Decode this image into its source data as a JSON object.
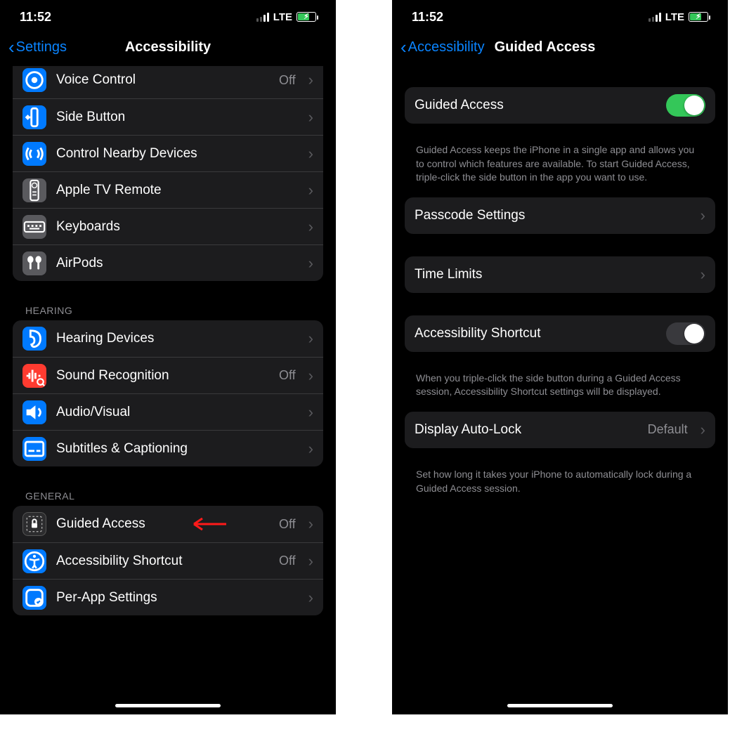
{
  "status": {
    "time": "11:52",
    "network": "LTE"
  },
  "left": {
    "back_label": "Settings",
    "title": "Accessibility",
    "group_physical": [
      {
        "label": "Voice Control",
        "value": "Off",
        "icon": "voice-control-icon",
        "color": "ic-blue"
      },
      {
        "label": "Side Button",
        "value": "",
        "icon": "side-button-icon",
        "color": "ic-blue"
      },
      {
        "label": "Control Nearby Devices",
        "value": "",
        "icon": "nearby-devices-icon",
        "color": "ic-blue"
      },
      {
        "label": "Apple TV Remote",
        "value": "",
        "icon": "appletv-remote-icon",
        "color": "ic-grey"
      },
      {
        "label": "Keyboards",
        "value": "",
        "icon": "keyboards-icon",
        "color": "ic-grey"
      },
      {
        "label": "AirPods",
        "value": "",
        "icon": "airpods-icon",
        "color": "ic-grey"
      }
    ],
    "section_hearing": "HEARING",
    "group_hearing": [
      {
        "label": "Hearing Devices",
        "value": "",
        "icon": "ear-icon",
        "color": "ic-blue"
      },
      {
        "label": "Sound Recognition",
        "value": "Off",
        "icon": "sound-recognition-icon",
        "color": "ic-red"
      },
      {
        "label": "Audio/Visual",
        "value": "",
        "icon": "audio-visual-icon",
        "color": "ic-blue"
      },
      {
        "label": "Subtitles & Captioning",
        "value": "",
        "icon": "subtitles-icon",
        "color": "ic-blue"
      }
    ],
    "section_general": "GENERAL",
    "group_general": [
      {
        "label": "Guided Access",
        "value": "Off",
        "icon": "guided-access-icon",
        "color": "ic-dark"
      },
      {
        "label": "Accessibility Shortcut",
        "value": "Off",
        "icon": "accessibility-icon",
        "color": "ic-blue"
      },
      {
        "label": "Per-App Settings",
        "value": "",
        "icon": "per-app-icon",
        "color": "ic-blue"
      }
    ]
  },
  "right": {
    "back_label": "Accessibility",
    "title": "Guided Access",
    "row_main": "Guided Access",
    "main_toggle_on": true,
    "main_footer": "Guided Access keeps the iPhone in a single app and allows you to control which features are available. To start Guided Access, triple-click the side button in the app you want to use.",
    "row_passcode": "Passcode Settings",
    "row_timelimits": "Time Limits",
    "row_shortcut": "Accessibility Shortcut",
    "shortcut_toggle_on": false,
    "shortcut_footer": "When you triple-click the side button during a Guided Access session, Accessibility Shortcut settings will be displayed.",
    "row_autolock": "Display Auto-Lock",
    "autolock_value": "Default",
    "autolock_footer": "Set how long it takes your iPhone to automatically lock during a Guided Access session."
  }
}
